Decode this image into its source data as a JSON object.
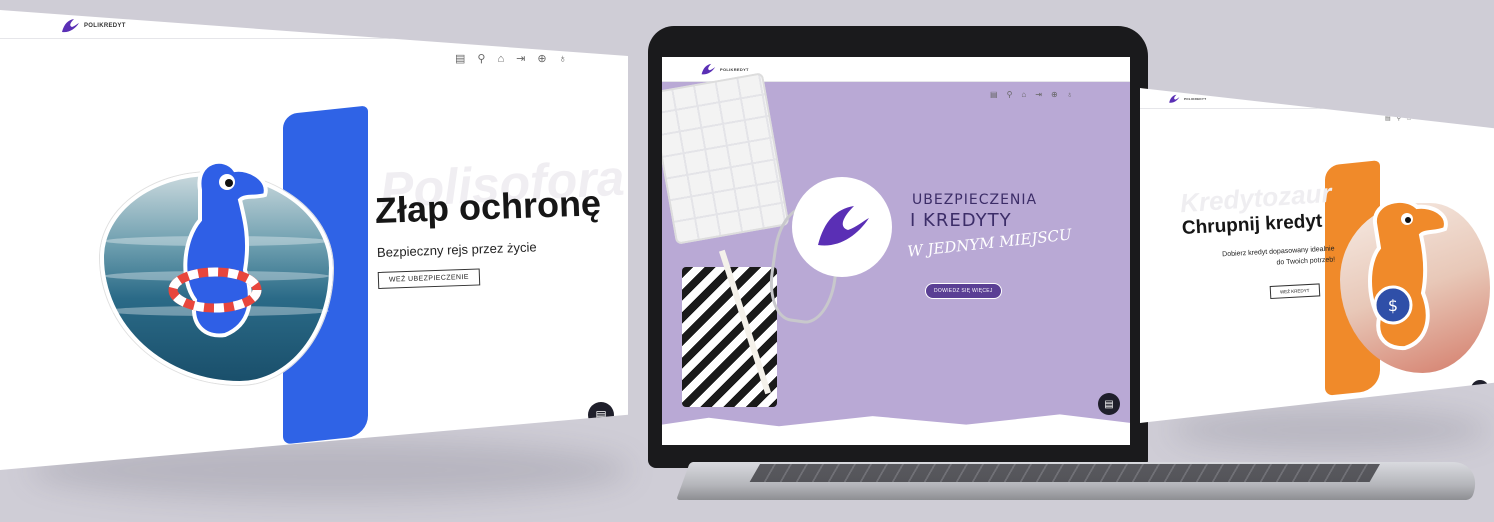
{
  "left_screen": {
    "brand": "POLIKREDYT",
    "nav_icons": [
      "document-icon",
      "location-pin-icon",
      "building-icon",
      "login-icon",
      "globe-icon",
      "money-bag-icon"
    ],
    "ghost_text": "Polisofora",
    "heading": "Złap ochronę",
    "subheading": "Bezpieczny rejs przez życie",
    "cta_label": "WEŹ UBEZPIECZENIE",
    "accent_color": "#2f63e6"
  },
  "laptop_screen": {
    "brand": "POLIKREDYT",
    "nav_icons": [
      "document-icon",
      "location-pin-icon",
      "building-icon",
      "login-icon",
      "globe-icon",
      "money-bag-icon"
    ],
    "title_line1": "UBEZPIECZENIA",
    "title_line2": "I KREDYTY",
    "title_line3": "W JEDNYM MIEJSCU",
    "cta_label": "DOWIEDZ SIĘ WIĘCEJ",
    "accent_color": "#b9a9d5"
  },
  "right_screen": {
    "brand": "POLIKREDYT",
    "nav_icons": [
      "document-icon",
      "location-pin-icon",
      "building-icon",
      "login-icon",
      "globe-icon",
      "money-bag-icon"
    ],
    "ghost_text": "Kredytozaur",
    "heading": "Chrupnij kredyt",
    "subheading_line1": "Dobierz kredyt dopasowany idealnie",
    "subheading_line2": "do Twoich potrzeb!",
    "cta_label": "WEŹ KREDYT",
    "accent_color": "#f08a2a"
  }
}
